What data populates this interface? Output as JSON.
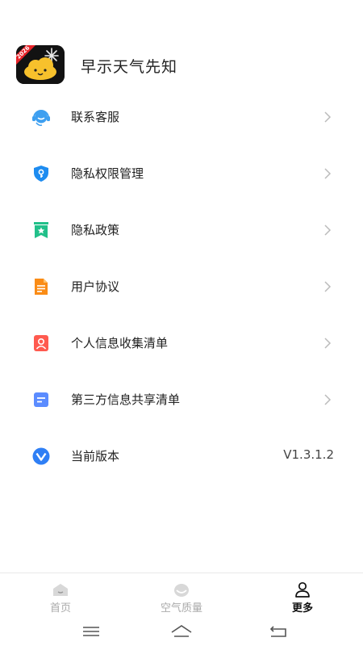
{
  "app": {
    "title": "早示天气先知",
    "logo_badge": "2026"
  },
  "menu": [
    {
      "label": "联系客服",
      "icon": "headset-icon"
    },
    {
      "label": "隐私权限管理",
      "icon": "shield-key-icon"
    },
    {
      "label": "隐私政策",
      "icon": "bookmark-star-icon"
    },
    {
      "label": "用户协议",
      "icon": "document-icon"
    },
    {
      "label": "个人信息收集清单",
      "icon": "user-card-icon"
    },
    {
      "label": "第三方信息共享清单",
      "icon": "file-list-icon"
    },
    {
      "label": "当前版本",
      "icon": "version-v-icon",
      "value": "V1.3.1.2"
    }
  ],
  "tabs": [
    {
      "label": "首页",
      "icon": "home-cloud-icon",
      "active": false
    },
    {
      "label": "空气质量",
      "icon": "air-quality-icon",
      "active": false
    },
    {
      "label": "更多",
      "icon": "user-icon",
      "active": true
    }
  ],
  "colors": {
    "headset": "#3d9ff0",
    "shield": "#1e8cf0",
    "bookmark": "#22c08a",
    "document": "#fa8c16",
    "user_card": "#ff5a4f",
    "file_list": "#5b8cff",
    "version": "#2f7ff5"
  }
}
